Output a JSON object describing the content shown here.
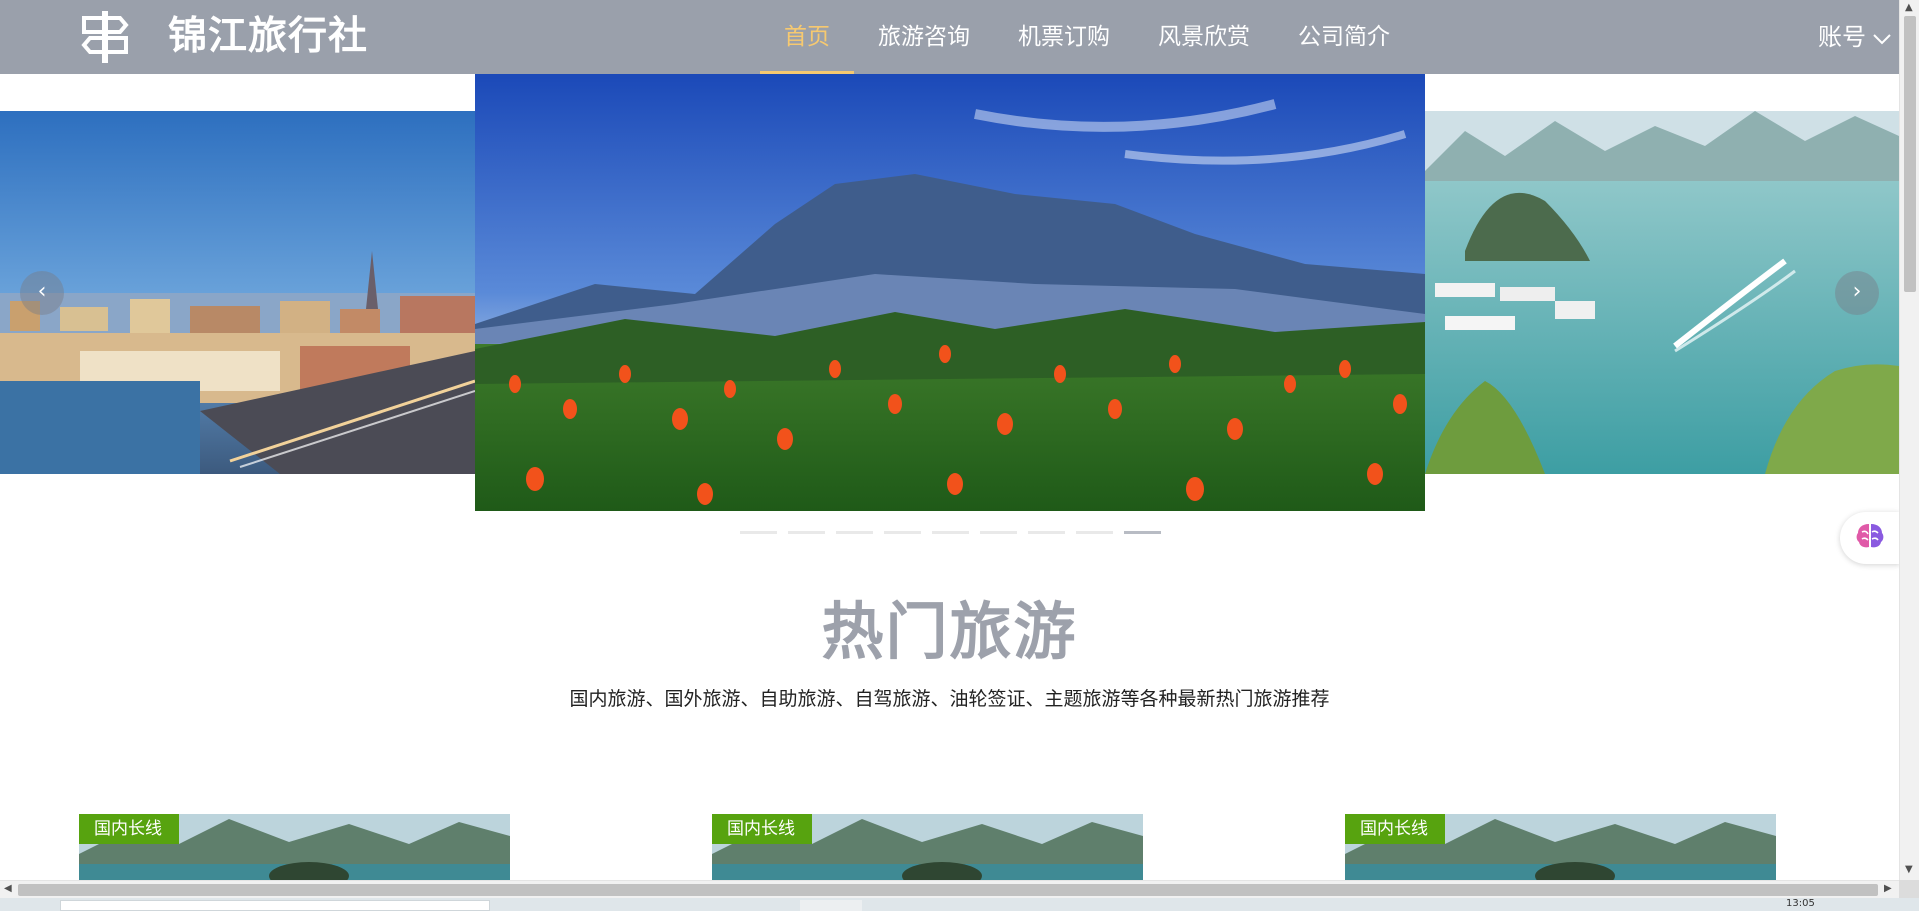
{
  "header": {
    "logo_text": "锦江旅行社",
    "nav": [
      {
        "label": "首页",
        "active": true
      },
      {
        "label": "旅游咨询",
        "active": false
      },
      {
        "label": "机票订购",
        "active": false
      },
      {
        "label": "风景欣赏",
        "active": false
      },
      {
        "label": "公司简介",
        "active": false
      }
    ],
    "account_label": "账号",
    "active_color": "#f6c970",
    "bar_color": "#9aa0ab"
  },
  "carousel": {
    "prev_icon": "chevron-left-icon",
    "next_icon": "chevron-right-icon",
    "prev_glyph": "‹",
    "next_glyph": "›",
    "indicator_count": 9,
    "active_indicator": 9
  },
  "hot_travel": {
    "title": "热门旅游",
    "subtitle": "国内旅游、国外旅游、自助旅游、自驾旅游、油轮签证、主题旅游等各种最新热门旅游推荐"
  },
  "cards": [
    {
      "badge": "国内长线"
    },
    {
      "badge": "国内长线"
    },
    {
      "badge": "国内长线"
    }
  ],
  "badge_color": "#57a30f",
  "taskbar": {
    "clock": "13:05"
  }
}
